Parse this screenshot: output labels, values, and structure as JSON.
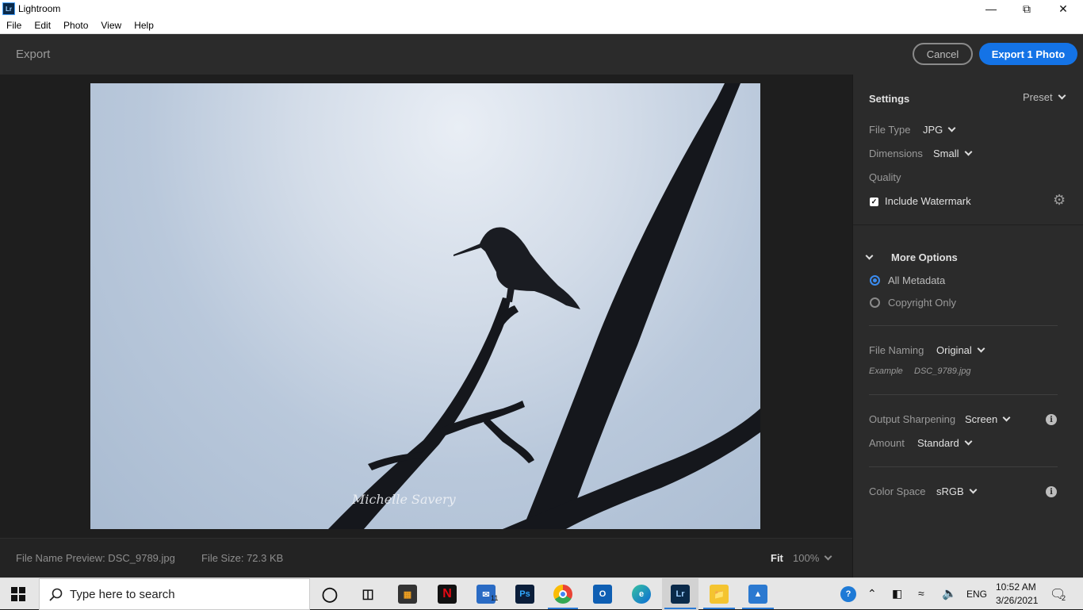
{
  "window": {
    "title": "Lightroom",
    "app_icon_text": "Lr"
  },
  "menu": [
    "File",
    "Edit",
    "Photo",
    "View",
    "Help"
  ],
  "header": {
    "title": "Export",
    "cancel_label": "Cancel",
    "export_label": "Export 1 Photo"
  },
  "photo": {
    "watermark_text": "Michelle Savery"
  },
  "footer": {
    "file_name_preview": "File Name Preview: DSC_9789.jpg",
    "file_size": "File Size: 72.3 KB",
    "fit_label": "Fit",
    "zoom_level": "100%"
  },
  "settings": {
    "heading": "Settings",
    "preset_label": "Preset",
    "file_type_label": "File Type",
    "file_type_value": "JPG",
    "dimensions_label": "Dimensions",
    "dimensions_value": "Small",
    "quality_label": "Quality",
    "watermark_label": "Include Watermark",
    "watermark_checked": true
  },
  "more_options": {
    "heading": "More Options",
    "metadata_options": [
      "All Metadata",
      "Copyright Only"
    ],
    "metadata_selected": "All Metadata",
    "file_naming_label": "File Naming",
    "file_naming_value": "Original",
    "example_label": "Example",
    "example_value": "DSC_9789.jpg",
    "output_sharpening_label": "Output Sharpening",
    "output_sharpening_value": "Screen",
    "amount_label": "Amount",
    "amount_value": "Standard",
    "color_space_label": "Color Space",
    "color_space_value": "sRGB"
  },
  "taskbar": {
    "search_placeholder": "Type here to search",
    "mail_badge": "11",
    "language": "ENG",
    "time": "10:52 AM",
    "date": "3/26/2021",
    "notification_count": "2",
    "accent_color": "#1473e6"
  }
}
